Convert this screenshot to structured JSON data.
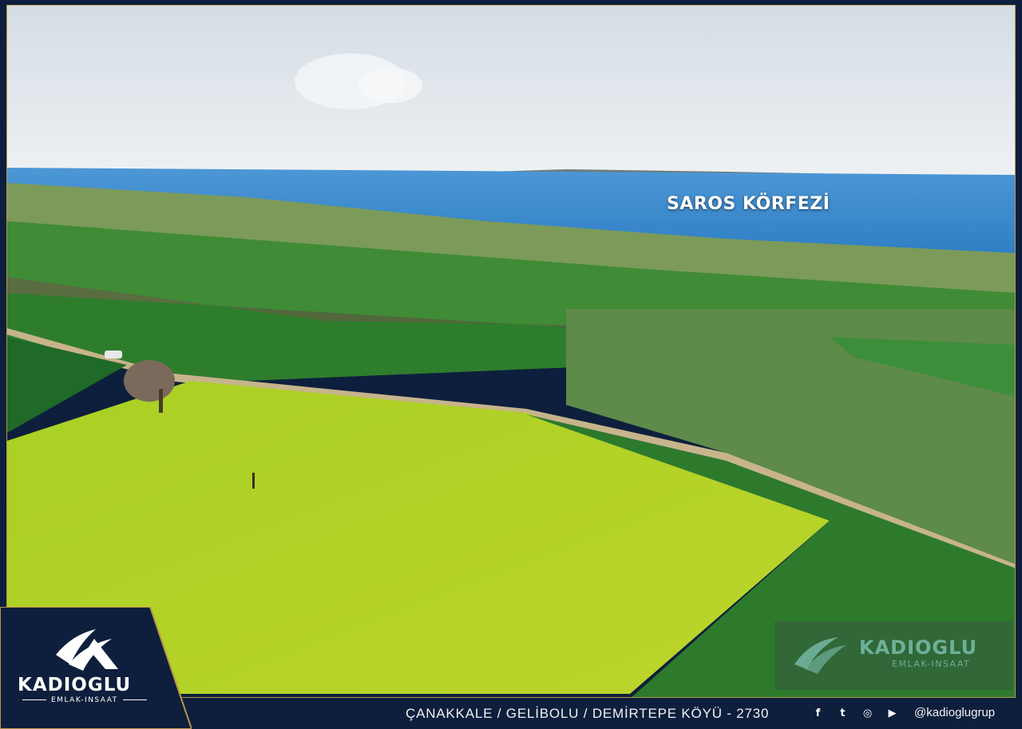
{
  "photo": {
    "place_label": "SAROS KÖRFEZİ"
  },
  "branding": {
    "logo_name": "KADIOGLU",
    "logo_subtitle": "EMLAK-INSAAT",
    "watermark_name": "KADIOGLU",
    "watermark_subtitle": "EMLAK-INSAAT"
  },
  "footer": {
    "location": "ÇANAKKALE / GELİBOLU  / DEMİRTEPE KÖYÜ - 2730",
    "social_icons": [
      "facebook-icon",
      "twitter-icon",
      "instagram-icon",
      "youtube-icon"
    ],
    "facebook_glyph": "f",
    "twitter_glyph": "t",
    "instagram_glyph": "◎",
    "youtube_glyph": "▶",
    "handle": "@kadioglugrup"
  },
  "colors": {
    "frame_navy": "#0d1f3c",
    "frame_gold": "#b8954a",
    "bright_field": "#b5d42a",
    "dark_field": "#2f7a2f",
    "sea": "#3f8fd0",
    "sky": "#dfe6ec"
  }
}
